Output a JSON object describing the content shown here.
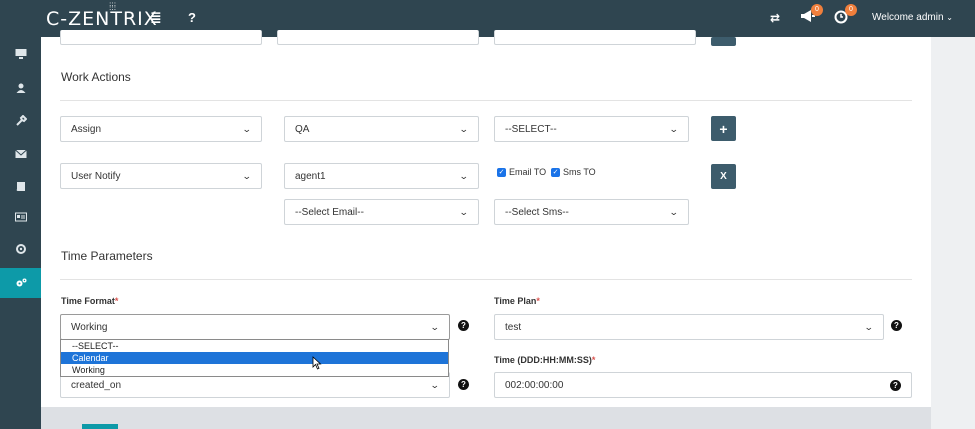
{
  "header": {
    "logo": "C-ZENTRIX",
    "notif_count_1": "0",
    "notif_count_2": "0",
    "welcome": "Welcome admin"
  },
  "sidebar": {
    "items": [
      {
        "icon": "monitor-icon"
      },
      {
        "icon": "user-icon"
      },
      {
        "icon": "wrench-icon"
      },
      {
        "icon": "envelope-icon"
      },
      {
        "icon": "book-icon"
      },
      {
        "icon": "id-card-icon"
      },
      {
        "icon": "recycle-icon"
      },
      {
        "icon": "cogs-icon",
        "active": true
      }
    ]
  },
  "work_actions": {
    "title": "Work Actions",
    "row1": {
      "action": "Assign",
      "target": "QA",
      "third": "--SELECT--"
    },
    "row2": {
      "action": "User Notify",
      "target": "agent1",
      "email_to": "Email TO",
      "sms_to": "Sms TO"
    },
    "row3": {
      "email": "--Select Email--",
      "sms": "--Select Sms--"
    },
    "add_label": "+",
    "remove_label": "X"
  },
  "time_parameters": {
    "title": "Time Parameters",
    "time_format_label": "Time Format",
    "time_format_value": "Working",
    "time_plan_label": "Time Plan",
    "time_plan_value": "test",
    "time_label": "Time (DDD:HH:MM:SS)",
    "time_value": "002:00:00:00",
    "field_value": "created_on",
    "required_mark": "*",
    "dropdown_options": [
      "--SELECT--",
      "Calendar",
      "Working"
    ],
    "highlighted_option": "Calendar"
  },
  "help_label": "?"
}
